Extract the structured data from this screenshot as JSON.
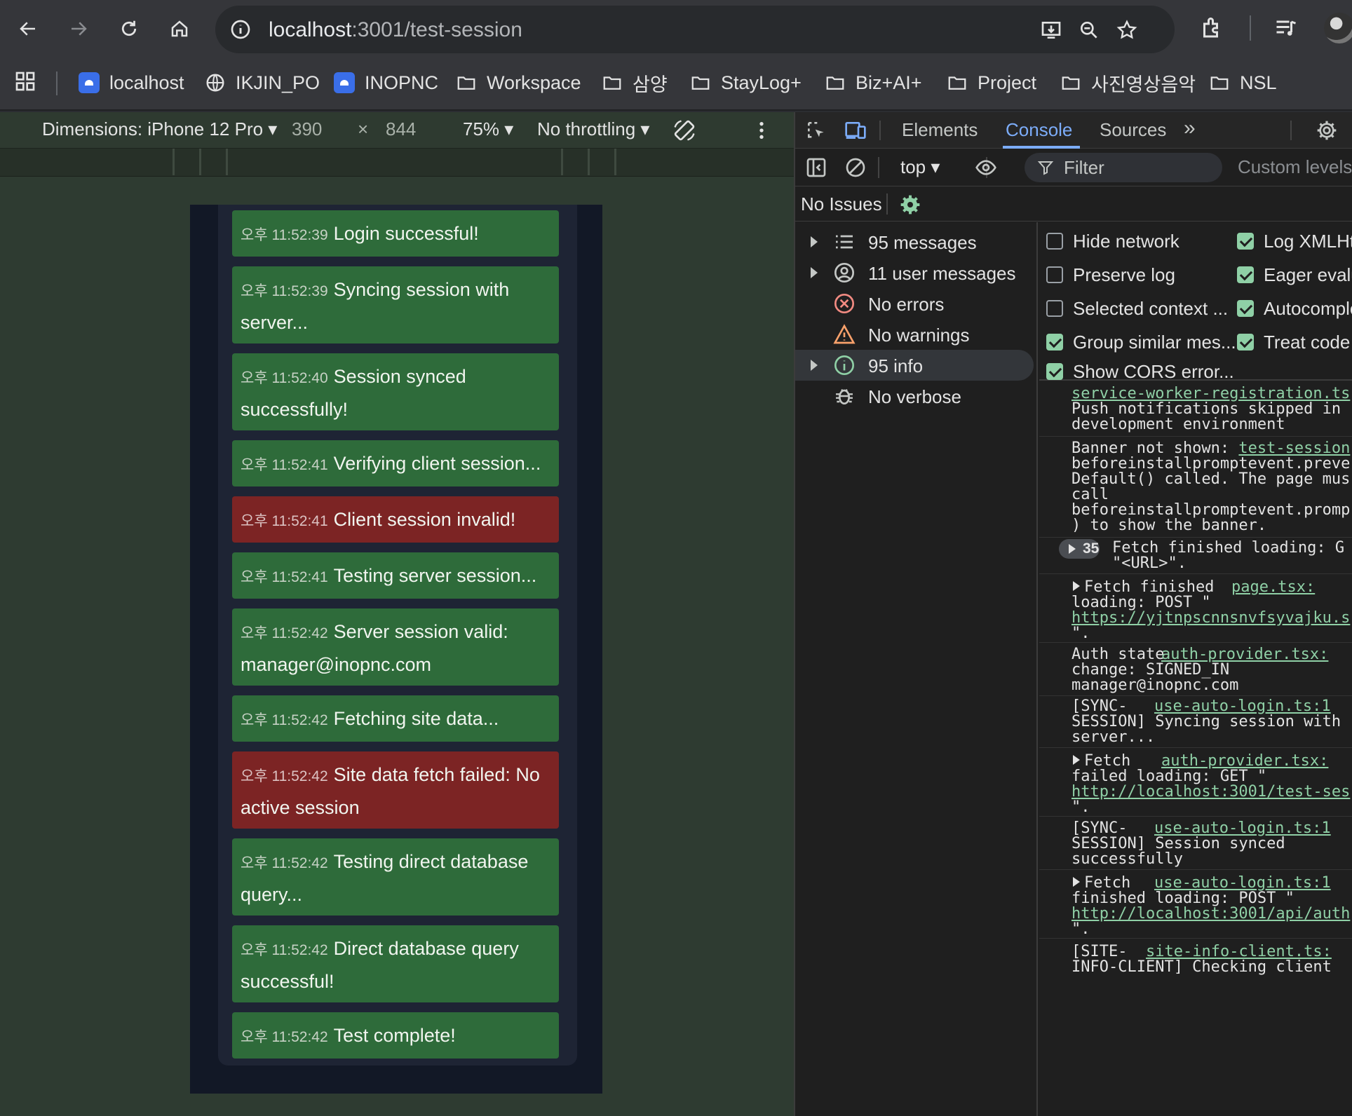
{
  "browser": {
    "url_host": "localhost",
    "url_path": ":3001/test-session"
  },
  "bookmarks": [
    {
      "label": "localhost",
      "type": "site"
    },
    {
      "label": "IKJIN_PO",
      "type": "globe"
    },
    {
      "label": "INOPNC",
      "type": "site"
    },
    {
      "label": "Workspace",
      "type": "folder"
    },
    {
      "label": "삼양",
      "type": "folder"
    },
    {
      "label": "StayLog+",
      "type": "folder"
    },
    {
      "label": "Biz+AI+",
      "type": "folder"
    },
    {
      "label": "Project",
      "type": "folder"
    },
    {
      "label": "사진영상음악",
      "type": "folder"
    },
    {
      "label": "NSL",
      "type": "folder"
    }
  ],
  "device_toolbar": {
    "dimensions": "Dimensions: iPhone 12 Pro",
    "width": "390",
    "times": "×",
    "height": "844",
    "zoom": "75%",
    "throttling": "No throttling"
  },
  "logs": [
    {
      "time": "오후 11:52:39",
      "text": "Login successful!",
      "status": "ok"
    },
    {
      "time": "오후 11:52:39",
      "text": "Syncing session with",
      "text2": "server...",
      "status": "ok"
    },
    {
      "time": "오후 11:52:40",
      "text": "Session synced",
      "text2": "successfully!",
      "status": "ok"
    },
    {
      "time": "오후 11:52:41",
      "text": "Verifying client session...",
      "status": "ok"
    },
    {
      "time": "오후 11:52:41",
      "text": "Client session invalid!",
      "status": "err"
    },
    {
      "time": "오후 11:52:41",
      "text": "Testing server session...",
      "status": "ok"
    },
    {
      "time": "오후 11:52:42",
      "text": "Server session valid:",
      "text2": "manager@inopnc.com",
      "status": "ok"
    },
    {
      "time": "오후 11:52:42",
      "text": "Fetching site data...",
      "status": "ok"
    },
    {
      "time": "오후 11:52:42",
      "text": "Site data fetch failed: No",
      "text2": "active session",
      "status": "err"
    },
    {
      "time": "오후 11:52:42",
      "text": "Testing direct database",
      "text2": "query...",
      "status": "ok"
    },
    {
      "time": "오후 11:52:42",
      "text": "Direct database query",
      "text2": "successful!",
      "status": "ok"
    },
    {
      "time": "오후 11:52:42",
      "text": "Test complete!",
      "status": "ok"
    }
  ],
  "devtools": {
    "tabs": [
      "Elements",
      "Console",
      "Sources"
    ],
    "active_tab": "Console",
    "context": "top",
    "filter_placeholder": "Filter",
    "custom_levels": "Custom levels",
    "issues": "No Issues",
    "sidebar": [
      {
        "label": "95 messages",
        "icon": "list-icon"
      },
      {
        "label": "11 user messages",
        "icon": "user-icon"
      },
      {
        "label": "No errors",
        "icon": "error-icon"
      },
      {
        "label": "No warnings",
        "icon": "warning-icon"
      },
      {
        "label": "95 info",
        "icon": "info-icon"
      },
      {
        "label": "No verbose",
        "icon": "bug-icon"
      }
    ],
    "settings": [
      {
        "label": "Hide network",
        "checked": false
      },
      {
        "label": "Log XMLHt",
        "checked": true
      },
      {
        "label": "Preserve log",
        "checked": false
      },
      {
        "label": "Eager evalu",
        "checked": true
      },
      {
        "label": "Selected context ...",
        "checked": false
      },
      {
        "label": "Autocomple",
        "checked": true
      },
      {
        "label": "Group similar mes...",
        "checked": true
      },
      {
        "label": "Treat code",
        "checked": true
      },
      {
        "label": "Show CORS error...",
        "checked": true
      }
    ],
    "console": {
      "m1_link": "service-worker-registration.ts",
      "m1_l1": "Push notifications skipped in",
      "m1_l2": "development environment",
      "m2_l1": "Banner not shown: ",
      "m2_link": "test-session",
      "m2_l2": "beforeinstallpromptevent.preve",
      "m2_l3": "Default() called. The page mus",
      "m2_l4": "call",
      "m2_l5": "beforeinstallpromptevent.promp",
      "m2_l6": ") to show the banner.",
      "m3_count": "35",
      "m3_l1": "Fetch finished loading: G",
      "m3_l2": "\"<URL>\".",
      "m4_l1": "Fetch finished",
      "m4_link": "page.tsx:",
      "m4_l2": "loading: POST \"",
      "m4_url": "https://yjtnpscnnsnvfsyvajku.s",
      "m4_l3": "\".",
      "m5_l1": "Auth state",
      "m5_link": "auth-provider.tsx:",
      "m5_l2": "change: SIGNED_IN",
      "m5_l3": "manager@inopnc.com",
      "m6_l1": "[SYNC-",
      "m6_link": "use-auto-login.ts:1",
      "m6_l2": "SESSION] Syncing session with",
      "m6_l3": "server...",
      "m7_l1": "Fetch",
      "m7_link": "auth-provider.tsx:",
      "m7_l2": "failed loading: GET \"",
      "m7_url": "http://localhost:3001/test-ses",
      "m7_l3": "\".",
      "m8_l1": "[SYNC-",
      "m8_link": "use-auto-login.ts:1",
      "m8_l2": "SESSION] Session synced",
      "m8_l3": "successfully",
      "m9_l1": "Fetch",
      "m9_link": "use-auto-login.ts:1",
      "m9_l2": "finished loading: POST \"",
      "m9_url": "http://localhost:3001/api/auth",
      "m9_l3": "\".",
      "m10_l1": "[SITE-",
      "m10_link": "site-info-client.ts:",
      "m10_l2": "INFO-CLIENT] Checking client"
    }
  },
  "colors": {
    "success": "#2e6b3a",
    "error": "#7c2424",
    "accent": "#7cacf8",
    "link": "#8fd0a6"
  }
}
